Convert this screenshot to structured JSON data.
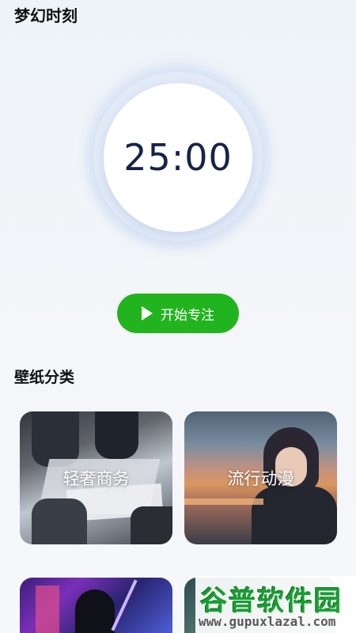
{
  "app": {
    "title": "梦幻时刻"
  },
  "timer": {
    "display": "25:00"
  },
  "start_button": {
    "label": "开始专注"
  },
  "wallpaper_section": {
    "title": "壁纸分类",
    "categories": [
      {
        "label": "轻奢商务"
      },
      {
        "label": "流行动漫"
      },
      {
        "label": ""
      },
      {
        "label": ""
      }
    ]
  },
  "watermark": {
    "brand": "谷普软件园",
    "url": "www.gupuxlazal.com"
  },
  "colors": {
    "accent_green": "#22b41f",
    "timer_text": "#14244a",
    "watermark_green": "#1b9b36"
  }
}
